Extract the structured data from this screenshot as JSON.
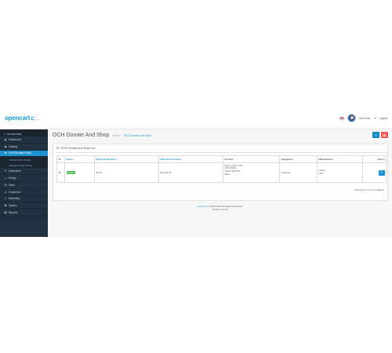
{
  "header": {
    "logo_text": "opencart",
    "logo_suffix": "3.x",
    "user_name": "John Doe",
    "logout_label": "Logout"
  },
  "sidebar": {
    "title": "NAVIGATION",
    "items": [
      {
        "icon": "dashboard-icon",
        "glyph": "◉",
        "label": "Dashboard",
        "chevron": ""
      },
      {
        "icon": "tag-icon",
        "glyph": "◆",
        "label": "Catalog",
        "chevron": "›"
      },
      {
        "icon": "gift-icon",
        "glyph": "■",
        "label": "OCH Donation Shop",
        "chevron": "›",
        "active": true
      }
    ],
    "subitems": [
      {
        "label": "OCH Donation Setting"
      },
      {
        "label": "Manage Donation Shop"
      }
    ],
    "more_items": [
      {
        "icon": "puzzle-icon",
        "glyph": "✦",
        "label": "Extensions",
        "chevron": "›"
      },
      {
        "icon": "tv-icon",
        "glyph": "▭",
        "label": "Design",
        "chevron": "›"
      },
      {
        "icon": "cart-icon",
        "glyph": "⊞",
        "label": "Sales",
        "chevron": "›"
      },
      {
        "icon": "user-icon",
        "glyph": "●",
        "label": "Customers",
        "chevron": "›"
      },
      {
        "icon": "share-icon",
        "glyph": "<",
        "label": "Marketing",
        "chevron": "›"
      },
      {
        "icon": "cog-icon",
        "glyph": "✱",
        "label": "System",
        "chevron": "›"
      },
      {
        "icon": "bar-chart-icon",
        "glyph": "▤",
        "label": "Reports",
        "chevron": "›"
      }
    ]
  },
  "page": {
    "title": "OCH Donate And Shop",
    "breadcrumb_home": "Home",
    "breadcrumb_sep": "›",
    "breadcrumb_current": "OCH Donate And Shop",
    "panel_title": "OCH Donate And Shop List"
  },
  "table": {
    "headers": {
      "status": "Status",
      "min": "Minimum Donation",
      "max": "Maximum Donation",
      "product": "Product",
      "categories": "Categories",
      "manufacturer": "Manufacturer",
      "action": "Action"
    },
    "row": {
      "status": "Enabled",
      "min": "$1.00",
      "max": "$11,111.00",
      "products": [
        "Apple Cinema 30\"",
        "HP LP3065",
        "Canon EOS 5D",
        "iMac"
      ],
      "categories": "Cameras",
      "manufacturers": [
        "Canon",
        "HTC"
      ]
    },
    "pagination": "Showing 1 to 1 of 1 (1 Pages)"
  },
  "footer": {
    "link": "OpenCart",
    "rights": "© 2009-2024 All Rights Reserved.",
    "version": "Version 3.0.3.8"
  },
  "colors": {
    "accent": "#1e91cf",
    "sidebar": "#22313f",
    "danger": "#f56b6b",
    "success": "#4cb64c"
  }
}
